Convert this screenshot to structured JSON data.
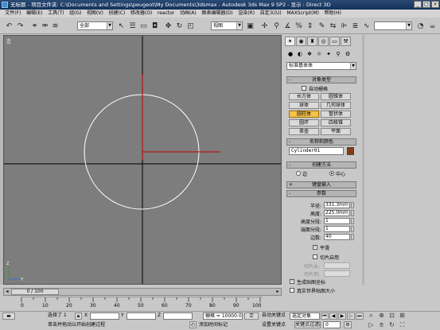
{
  "window": {
    "title": "无标题 - 项目文件夹: C:\\Documents and Settings\\peugeot\\My Documents\\3dsmax - Autodesk 3ds Max 9 SP2 - 显示 : Direct 3D",
    "controls": [
      "_",
      "□",
      "×"
    ]
  },
  "menu": [
    "文件(F)",
    "编辑(E)",
    "工具(T)",
    "组(G)",
    "视图(V)",
    "创建(C)",
    "修改器(O)",
    "reactor",
    "动画(A)",
    "图表编辑器(D)",
    "渲染(R)",
    "自定义(U)",
    "MAXScript(M)",
    "帮助(H)"
  ],
  "toolbar": {
    "selection_filter": "全部",
    "ref_coord": "视图",
    "named_selection": ""
  },
  "viewport": {
    "label": "左",
    "icons": {
      "axis": "axis-tripod-icon"
    },
    "colors": {
      "bg": "#7d7d7d",
      "grid": "#000000",
      "circle": "#ffffff",
      "gizmo": "#c00000"
    }
  },
  "command_panel": {
    "tabs": [
      "create-tab",
      "modify-tab",
      "hierarchy-tab",
      "motion-tab",
      "display-tab",
      "utilities-tab"
    ],
    "tab_glyphs": [
      "✶",
      "◉",
      "♜",
      "◎",
      "▭",
      "⚒"
    ],
    "category_glyphs": [
      "●",
      "◐",
      "❖",
      "☼",
      "✦",
      "⚲",
      "⚙"
    ],
    "primitive_type": "标准基本体",
    "object_type": {
      "title": "对象类型",
      "autogrid": "自动栅格",
      "buttons": [
        {
          "label": "长方体",
          "active": false
        },
        {
          "label": "圆锥体",
          "active": false
        },
        {
          "label": "球体",
          "active": false
        },
        {
          "label": "几何球体",
          "active": false
        },
        {
          "label": "圆柱体",
          "active": true
        },
        {
          "label": "管状体",
          "active": false
        },
        {
          "label": "圆环",
          "active": false
        },
        {
          "label": "四棱锥",
          "active": false
        },
        {
          "label": "茶壶",
          "active": false
        },
        {
          "label": "平面",
          "active": false
        }
      ]
    },
    "name_color": {
      "title": "名称和颜色",
      "name": "Cylinder01",
      "color": "#8a3a14"
    },
    "creation_method": {
      "title": "创建方法",
      "options": [
        "边",
        "中心"
      ],
      "selected": "中心"
    },
    "keyboard_entry": {
      "title": "键盘输入"
    },
    "parameters": {
      "title": "参数",
      "fields": [
        {
          "label": "半径:",
          "value": "331.3mm"
        },
        {
          "label": "高度:",
          "value": "225.0mm"
        },
        {
          "label": "高度分段:",
          "value": "1"
        },
        {
          "label": "端面分段:",
          "value": "1"
        },
        {
          "label": "边数:",
          "value": "40"
        }
      ],
      "smooth": "平滑",
      "slice_on": "切片启用",
      "slice_from": "切片从:",
      "slice_to": "切片到:",
      "gen_mapping": "生成贴图坐标",
      "real_world": "真实世界贴图大小"
    }
  },
  "timeline": {
    "position": "0 / 100",
    "ticks": [
      "0",
      "10",
      "20",
      "30",
      "40",
      "50",
      "60",
      "70",
      "80",
      "90",
      "100"
    ]
  },
  "status": {
    "selected": "选择了 1",
    "prompt": "单击并拖动以开始创建过程",
    "x_value": "",
    "y_value": "",
    "z_value": "",
    "grid": "栅格 = 10000.0m",
    "auto_key": "自动关键点",
    "set_key": "设置关键点",
    "key_filter_set": "选定对象",
    "key_filters": "关键点过滤器...",
    "add_time_tag": "添加时间标记",
    "frame": "0"
  }
}
